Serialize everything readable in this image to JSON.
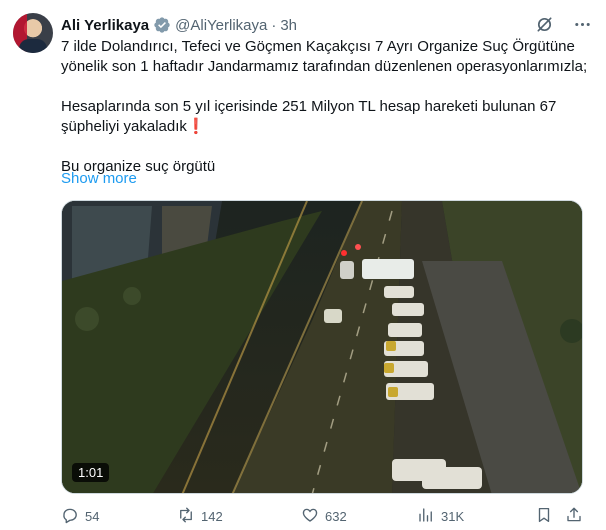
{
  "author": {
    "name": "Ali Yerlikaya",
    "handle": "@AliYerlikaya",
    "separator": "·",
    "time": "3h"
  },
  "tweet": {
    "paragraph1": "7 ilde Dolandırıcı, Tefeci ve Göçmen Kaçakçısı 7 Ayrı Organize Suç Örgütüne yönelik son 1 haftadır Jandarmamız tarafından düzenlenen operasyonlarımızla;",
    "paragraph2": "Hesaplarında son 5 yıl içerisinde 251 Milyon TL hesap hareketi bulunan 67 şüpheliyi yakaladık❗",
    "paragraph3": "Bu organize suç örgütü",
    "show_more": "Show more"
  },
  "media": {
    "duration": "1:01"
  },
  "actions": {
    "replies": "54",
    "reposts": "142",
    "likes": "632",
    "views": "31K"
  },
  "colors": {
    "accent": "#1d9bf0",
    "secondary_text": "#536471",
    "primary_text": "#0f1419"
  },
  "icons": [
    "verified-badge-icon",
    "grok-icon",
    "more-icon",
    "reply-icon",
    "repost-icon",
    "like-icon",
    "views-icon",
    "bookmark-icon",
    "share-icon"
  ]
}
